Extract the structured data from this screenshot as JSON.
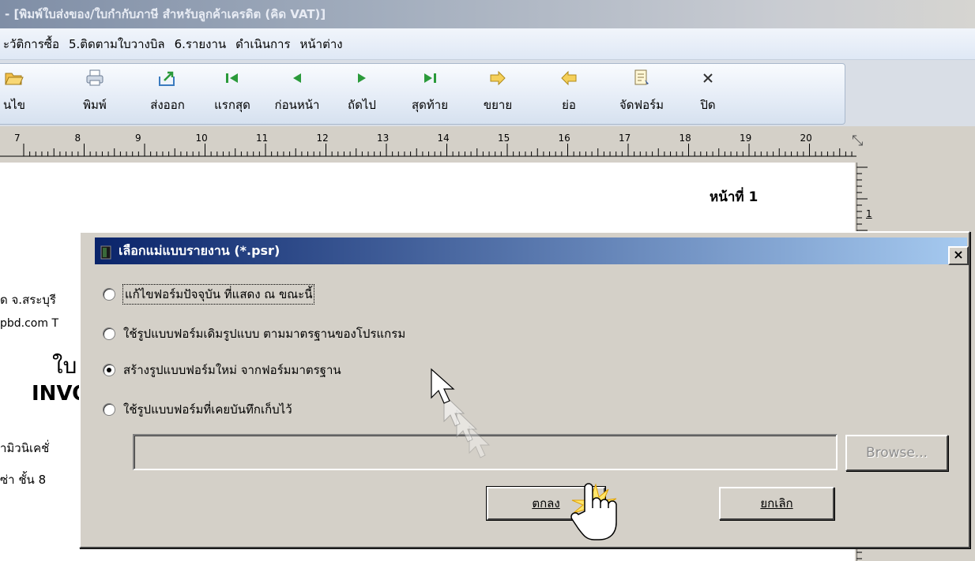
{
  "window": {
    "title": "- [พิมพ์ใบส่งของ/ใบกำกับภาษี สำหรับลูกค้าเครดิต (คิด VAT)]"
  },
  "menu": {
    "items": [
      "ะวัติการซื้อ",
      "5.ติดตามใบวางบิล",
      "6.รายงาน",
      "ดำเนินการ",
      "หน้าต่าง"
    ]
  },
  "toolbar": {
    "buttons": [
      {
        "label": "นไข",
        "icon": "folder-open-icon"
      },
      {
        "label": "พิมพ์",
        "icon": "printer-icon"
      },
      {
        "label": "ส่งออก",
        "icon": "export-icon"
      },
      {
        "label": "แรกสุด",
        "icon": "first-page-icon"
      },
      {
        "label": "ก่อนหน้า",
        "icon": "previous-page-icon"
      },
      {
        "label": "ถัดไป",
        "icon": "next-page-icon"
      },
      {
        "label": "สุดท้าย",
        "icon": "last-page-icon"
      },
      {
        "label": "ขยาย",
        "icon": "zoom-in-icon"
      },
      {
        "label": "ย่อ",
        "icon": "zoom-out-icon"
      },
      {
        "label": "จัดฟอร์ม",
        "icon": "form-design-icon"
      },
      {
        "label": "ปิด",
        "icon": "close-icon"
      }
    ]
  },
  "ruler": {
    "ticks": [
      "7",
      "8",
      "9",
      "10",
      "11",
      "12",
      "13",
      "14",
      "15",
      "16",
      "17",
      "18",
      "19",
      "20"
    ],
    "vertical_tick": "1"
  },
  "document": {
    "page_label": "หน้าที่ 1",
    "fragments": [
      "ด จ.สระบุรี",
      "pbd.com T",
      "ใบ",
      "INVO",
      "ามิวนิเคชั่",
      "ซ่า ชั้น 8"
    ]
  },
  "dialog": {
    "title": "เลือกแม่แบบรายงาน (*.psr)",
    "close_symbol": "×",
    "options": [
      {
        "label": "แก้ไขฟอร์มปัจจุบัน ที่แสดง ณ ขณะนี้",
        "selected": false
      },
      {
        "label": "ใช้รูปแบบฟอร์มเดิมรูปแบบ ตามมาตรฐานของโปรแกรม",
        "selected": false
      },
      {
        "label": "สร้างรูปแบบฟอร์มใหม่ จากฟอร์มมาตรฐาน",
        "selected": true
      },
      {
        "label": "ใช้รูปแบบฟอร์มที่เคยบันทึกเก็บไว้",
        "selected": false
      }
    ],
    "path_value": "",
    "browse_label": "Browse...",
    "ok_label": "ตกลง",
    "cancel_label": "ยกเลิก"
  }
}
